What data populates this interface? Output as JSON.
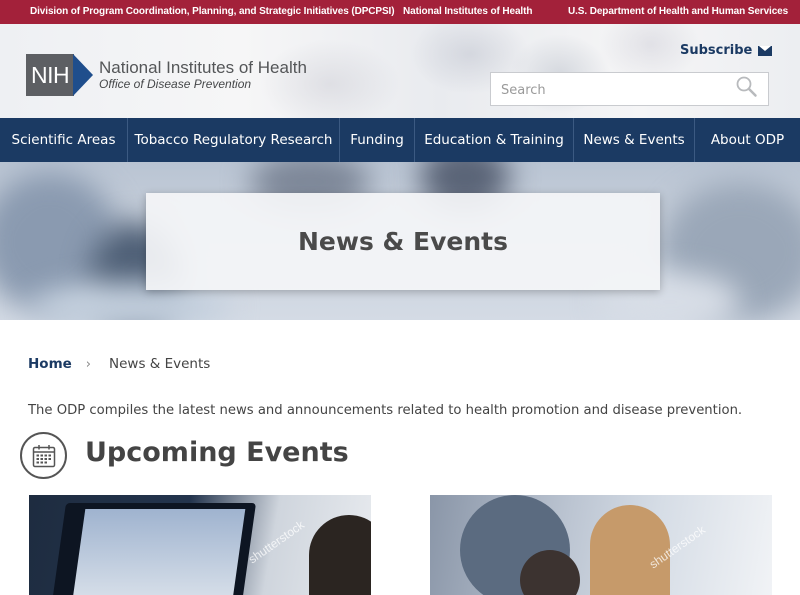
{
  "topbar": {
    "dpcpsi": "Division of Program Coordination, Planning, and Strategic Initiatives (DPCPSI)",
    "nih": "National Institutes of Health",
    "hhs": "U.S. Department of Health and Human Services"
  },
  "header": {
    "logo_mark": "NIH",
    "logo_title": "National Institutes of Health",
    "logo_subtitle": "Office of Disease Prevention",
    "subscribe_label": "Subscribe",
    "search_placeholder": "Search"
  },
  "nav": {
    "items": [
      {
        "label": "Scientific Areas"
      },
      {
        "label": "Tobacco Regulatory Research"
      },
      {
        "label": "Funding"
      },
      {
        "label": "Education & Training"
      },
      {
        "label": "News & Events"
      },
      {
        "label": "About ODP"
      }
    ]
  },
  "hero": {
    "title": "News & Events"
  },
  "breadcrumb": {
    "home": "Home",
    "separator": "›",
    "current": "News & Events"
  },
  "intro": "The ODP compiles the latest news and announcements related to health promotion and disease prevention.",
  "events": {
    "title": "Upcoming Events",
    "watermark_1": "shutterstock",
    "watermark_2": "shutterstock"
  },
  "colors": {
    "topbar": "#a3213a",
    "nav": "#1b3a63",
    "link": "#1b3a63"
  },
  "icons": [
    "mail-icon",
    "search-icon",
    "calendar-icon",
    "nih-logo-chevron"
  ]
}
